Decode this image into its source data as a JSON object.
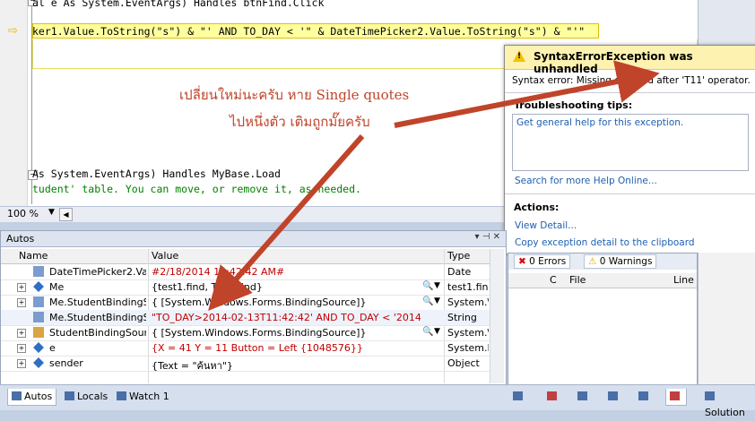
{
  "editor": {
    "line_top": "al e As System.EventArgs) Handles btnFind.Click",
    "line_current": "ker1.Value.ToString(\"s\") & \"' AND TO_DAY < '\" & DateTimePicker2.Value.ToString(\"s\") & \"'\"",
    "line_load": "As System.EventArgs) Handles MyBase.Load",
    "line_comment": "tudent' table. You can move, or remove it, as needed."
  },
  "zoom": {
    "value": "100 %"
  },
  "annotations": {
    "line1": "เปลี่ยนใหม่นะครับ หาย Single quotes",
    "line2": "ไปหนึ่งตัว เติมถูกมั๊ยครับ"
  },
  "exception": {
    "title": "SyntaxErrorException was unhandled",
    "message": "Syntax error: Missing operand after 'T11' operator.",
    "tips_title": "Troubleshooting tips:",
    "tip_link": "Get general help for this exception.",
    "search_link": "Search for more Help Online...",
    "actions_title": "Actions:",
    "view_detail": "View Detail...",
    "copy_detail": "Copy exception detail to the clipboard"
  },
  "autos": {
    "title": "Autos",
    "pin": "▾ ⊣ ✕",
    "columns": [
      "Name",
      "Value",
      "Type"
    ],
    "rows": [
      {
        "name": "DateTimePicker2.Val",
        "value": "#2/18/2014 11:42:42 AM#",
        "type": "Date",
        "red": true
      },
      {
        "name": "Me",
        "value": "{test1.find, Text: find}",
        "type": "test1.find",
        "red": false
      },
      {
        "name": "Me.StudentBindingS",
        "value": "{ [System.Windows.Forms.BindingSource]}",
        "type": "System.\\",
        "red": false
      },
      {
        "name": "Me.StudentBindingS",
        "value": "\"TO_DAY>2014-02-13T11:42:42' AND TO_DAY < '2014-02",
        "type": "String",
        "red": true
      },
      {
        "name": "StudentBindingSourc",
        "value": "{ [System.Windows.Forms.BindingSource]}",
        "type": "System.\\",
        "red": false
      },
      {
        "name": "e",
        "value": "{X = 41 Y = 11 Button = Left {1048576}}",
        "type": "System.E",
        "red": true
      },
      {
        "name": "sender",
        "value": "{Text = \"ค้นหา\"}",
        "type": "Object",
        "red": false
      }
    ]
  },
  "errors": {
    "errors_label": "0 Errors",
    "warnings_label": "0 Warnings",
    "col_c": "C",
    "col_file": "File",
    "col_line": "Line"
  },
  "tabs": {
    "autos": "Autos",
    "locals": "Locals",
    "watch": "Watch 1",
    "solution": "Solution"
  },
  "colors": {
    "annotation": "#c0442a",
    "link": "#1e5fb0",
    "header": "#fdf2b0"
  }
}
